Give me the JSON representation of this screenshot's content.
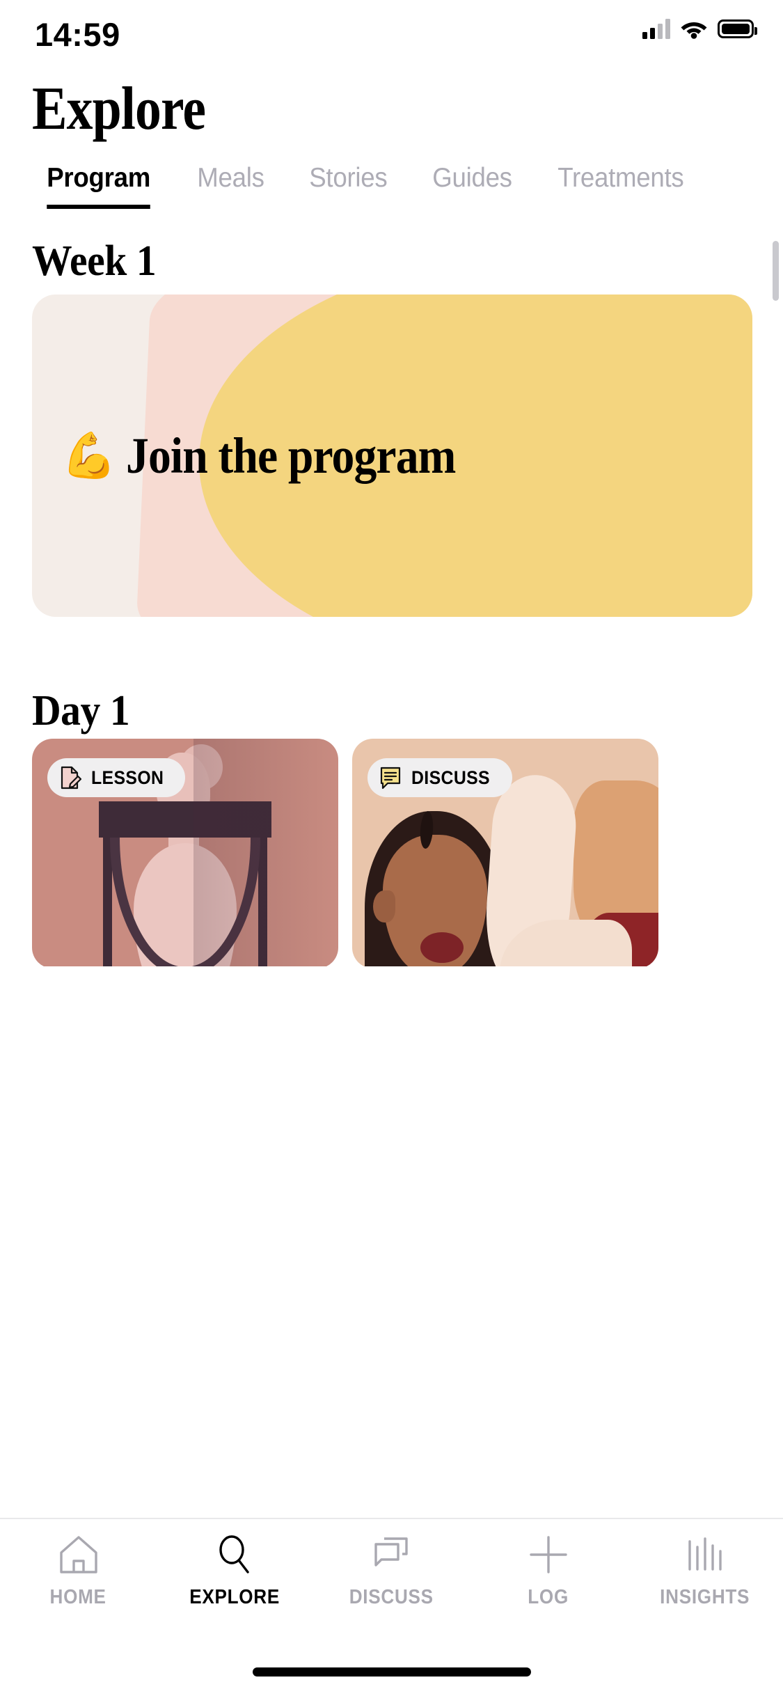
{
  "status_bar": {
    "time": "14:59",
    "icons": [
      "cellular-signal-icon",
      "wifi-icon",
      "battery-icon"
    ]
  },
  "header": {
    "title": "Explore"
  },
  "segment_tabs": {
    "active": "Program",
    "items": [
      {
        "label": "Program",
        "active": true
      },
      {
        "label": "Meals",
        "active": false
      },
      {
        "label": "Stories",
        "active": false
      },
      {
        "label": "Guides",
        "active": false
      },
      {
        "label": "Treatments",
        "active": false
      }
    ]
  },
  "content": {
    "week_heading": "Week 1",
    "hero_card": {
      "emoji": "💪",
      "label": "Join the program",
      "colors": {
        "cream": "#F4EDE8",
        "pink": "#F7DBD2",
        "yellow": "#F4D57F"
      }
    },
    "day_heading": "Day 1",
    "day_cards": [
      {
        "badge_label": "LESSON",
        "badge_icon": "document-pencil-icon",
        "background": "#C98C81"
      },
      {
        "badge_label": "DISCUSS",
        "badge_icon": "speech-bubble-icon",
        "background": "#E9C5AB"
      }
    ]
  },
  "bottom_nav": {
    "active": "EXPLORE",
    "items": [
      {
        "label": "HOME",
        "icon": "home-icon",
        "active": false
      },
      {
        "label": "EXPLORE",
        "icon": "search-icon",
        "active": true
      },
      {
        "label": "DISCUSS",
        "icon": "chat-bubbles-icon",
        "active": false
      },
      {
        "label": "LOG",
        "icon": "plus-icon",
        "active": false
      },
      {
        "label": "INSIGHTS",
        "icon": "bar-chart-icon",
        "active": false
      }
    ]
  }
}
